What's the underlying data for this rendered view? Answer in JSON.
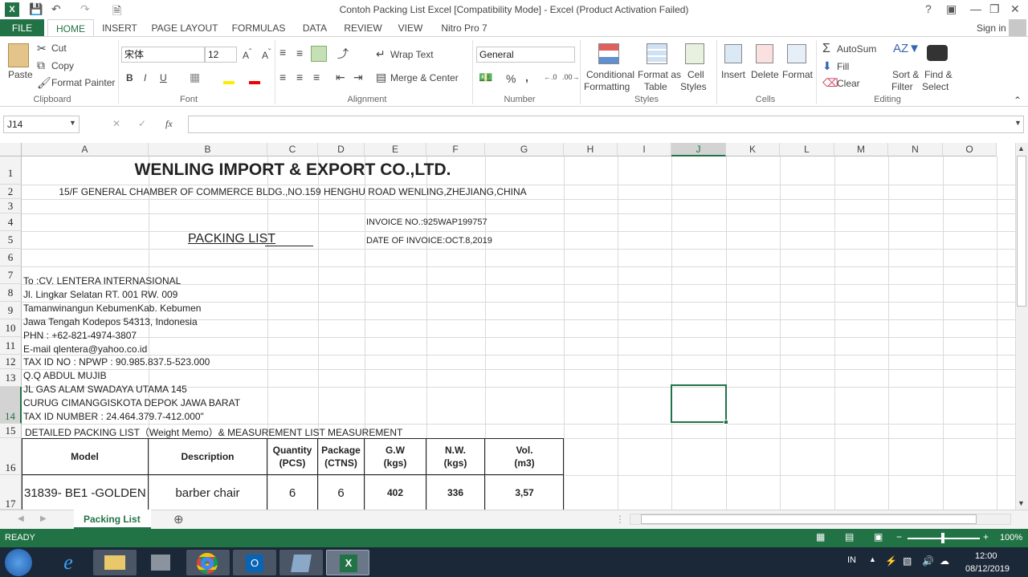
{
  "window": {
    "title": "Contoh Packing List Excel  [Compatibility Mode] - Excel (Product Activation Failed)",
    "help": "?",
    "signin": "Sign in"
  },
  "tabs": [
    "FILE",
    "HOME",
    "INSERT",
    "PAGE LAYOUT",
    "FORMULAS",
    "DATA",
    "REVIEW",
    "VIEW",
    "Nitro Pro 7"
  ],
  "ribbon": {
    "clipboard": {
      "group": "Clipboard",
      "paste": "Paste",
      "cut": "Cut",
      "copy": "Copy",
      "format_painter": "Format Painter"
    },
    "font": {
      "group": "Font",
      "name": "宋体",
      "size": "12",
      "bold": "B",
      "italic": "I",
      "underline": "U"
    },
    "alignment": {
      "group": "Alignment",
      "wrap": "Wrap Text",
      "merge": "Merge & Center"
    },
    "number": {
      "group": "Number",
      "format": "General",
      "percent": "%",
      "comma": ","
    },
    "styles": {
      "group": "Styles",
      "conditional": "Conditional",
      "formatting": "Formatting",
      "format_as": "Format as",
      "table": "Table",
      "cell": "Cell",
      "styles": "Styles"
    },
    "cells": {
      "group": "Cells",
      "insert": "Insert",
      "delete": "Delete",
      "format": "Format"
    },
    "editing": {
      "group": "Editing",
      "autosum": "AutoSum",
      "fill": "Fill",
      "clear": "Clear",
      "sort": "Sort &",
      "filter": "Filter",
      "find": "Find &",
      "select": "Select"
    }
  },
  "formula_bar": {
    "name_box": "J14",
    "fx": "fx",
    "value": ""
  },
  "columns": [
    "A",
    "B",
    "C",
    "D",
    "E",
    "F",
    "G",
    "H",
    "I",
    "J",
    "K",
    "L",
    "M",
    "N",
    "O"
  ],
  "rows": [
    "1",
    "2",
    "3",
    "4",
    "5",
    "6",
    "7",
    "8",
    "9",
    "10",
    "11",
    "12",
    "13",
    "14",
    "15",
    "16",
    "17"
  ],
  "sheet": {
    "company": "WENLING IMPORT & EXPORT CO.,LTD.",
    "address": "15/F GENERAL CHAMBER OF COMMERCE BLDG.,NO.159 HENGHU ROAD WENLING,ZHEJIANG,CHINA",
    "invoice_no": "INVOICE NO.:925WAP199757",
    "packing_list": "PACKING LIST",
    "invoice_date": "DATE OF INVOICE:OCT.8,2019",
    "to_lines": [
      "To :CV. LENTERA INTERNASIONAL",
      "Jl. Lingkar  Selatan RT. 001 RW. 009",
      "Tamanwinangun KebumenKab. Kebumen",
      "Jawa Tengah  Kodepos 54313, Indonesia",
      "PHN : +62-821-4974-3807",
      "E-mail qlentera@yahoo.co.id",
      "TAX ID NO : NPWP : 90.985.837.5-523.000",
      "Q.Q  ABDUL MUJIB",
      "JL GAS ALAM SWADAYA UTAMA 145",
      "CURUG CIMANGGISKOTA DEPOK JAWA BARAT",
      "TAX ID NUMBER : 24.464.379.7-412.000\""
    ],
    "detail_title": "DETAILED PACKING LIST（Weight Memo）& MEASUREMENT LIST MEASUREMENT",
    "headers": {
      "model": "Model",
      "description": "Description",
      "qty1": "Quantity",
      "qty2": "(PCS)",
      "pkg1": "Package",
      "pkg2": "(CTNS)",
      "gw1": "G.W",
      "gw2": "(kgs)",
      "nw1": "N.W.",
      "nw2": "(kgs)",
      "vol1": "Vol.",
      "vol2": "(m3)"
    },
    "row17": {
      "model": "31839- BE1 -GOLDEN",
      "description": "barber  chair",
      "qty": "6",
      "pkg": "6",
      "gw": "402",
      "nw": "336",
      "vol": "3,57"
    }
  },
  "sheet_tab": "Packing List",
  "status": {
    "ready": "READY",
    "zoom": "100%"
  },
  "taskbar": {
    "lang": "IN",
    "time": "12:00",
    "date": "08/12/2019"
  }
}
